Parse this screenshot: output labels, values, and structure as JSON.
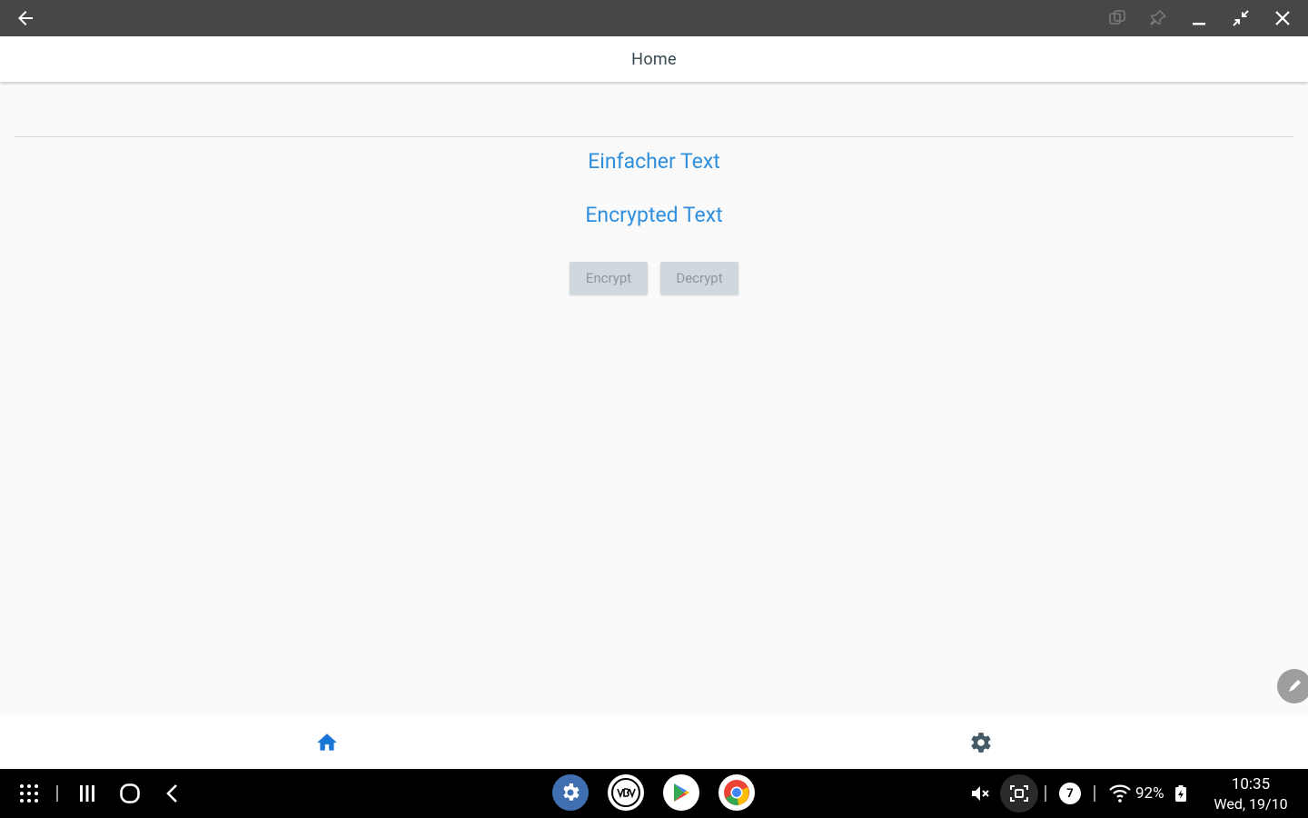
{
  "app": {
    "title": "Home"
  },
  "main": {
    "plain_text_label": "Einfacher Text",
    "encrypted_text_label": "Encrypted Text",
    "encrypt_label": "Encrypt",
    "decrypt_label": "Decrypt"
  },
  "bottom_nav": {
    "items": [
      {
        "icon": "home-icon",
        "active": true
      },
      {
        "icon": "gear-icon",
        "active": false
      }
    ]
  },
  "status": {
    "notification_count": "7",
    "battery": "92%",
    "time": "10:35",
    "date": "Wed, 19/10"
  },
  "colors": {
    "accent": "#2f8fdd",
    "window_bar": "#474747",
    "taskbar": "#000000",
    "button_bg": "#cfd8dc"
  }
}
